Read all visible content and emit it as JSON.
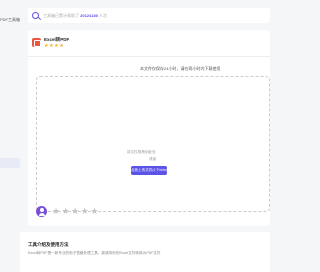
{
  "sidebar": {
    "tools_label": "PDF工具箱",
    "active_item": ""
  },
  "search": {
    "placeholder_prefix": "工具箱已累计帮助了",
    "count": "20124180",
    "placeholder_suffix": "人次"
  },
  "tool": {
    "title": "Excel转PDF",
    "rating_stars": 4,
    "notice": "本文件仅保存24小时，请在两小时内下载使用"
  },
  "upload": {
    "hint": "将文件拖拽到此处",
    "or": "或者",
    "button": "点我上传文件(1个/min)"
  },
  "feedback": {
    "stars_total": 5,
    "stars_selected": 0
  },
  "intro": {
    "title": "工具介绍及使用方法",
    "description": "Excel转PDF是一款专业的电子表格处理工具，能够将你的Excel文件转换为PDF文件"
  }
}
